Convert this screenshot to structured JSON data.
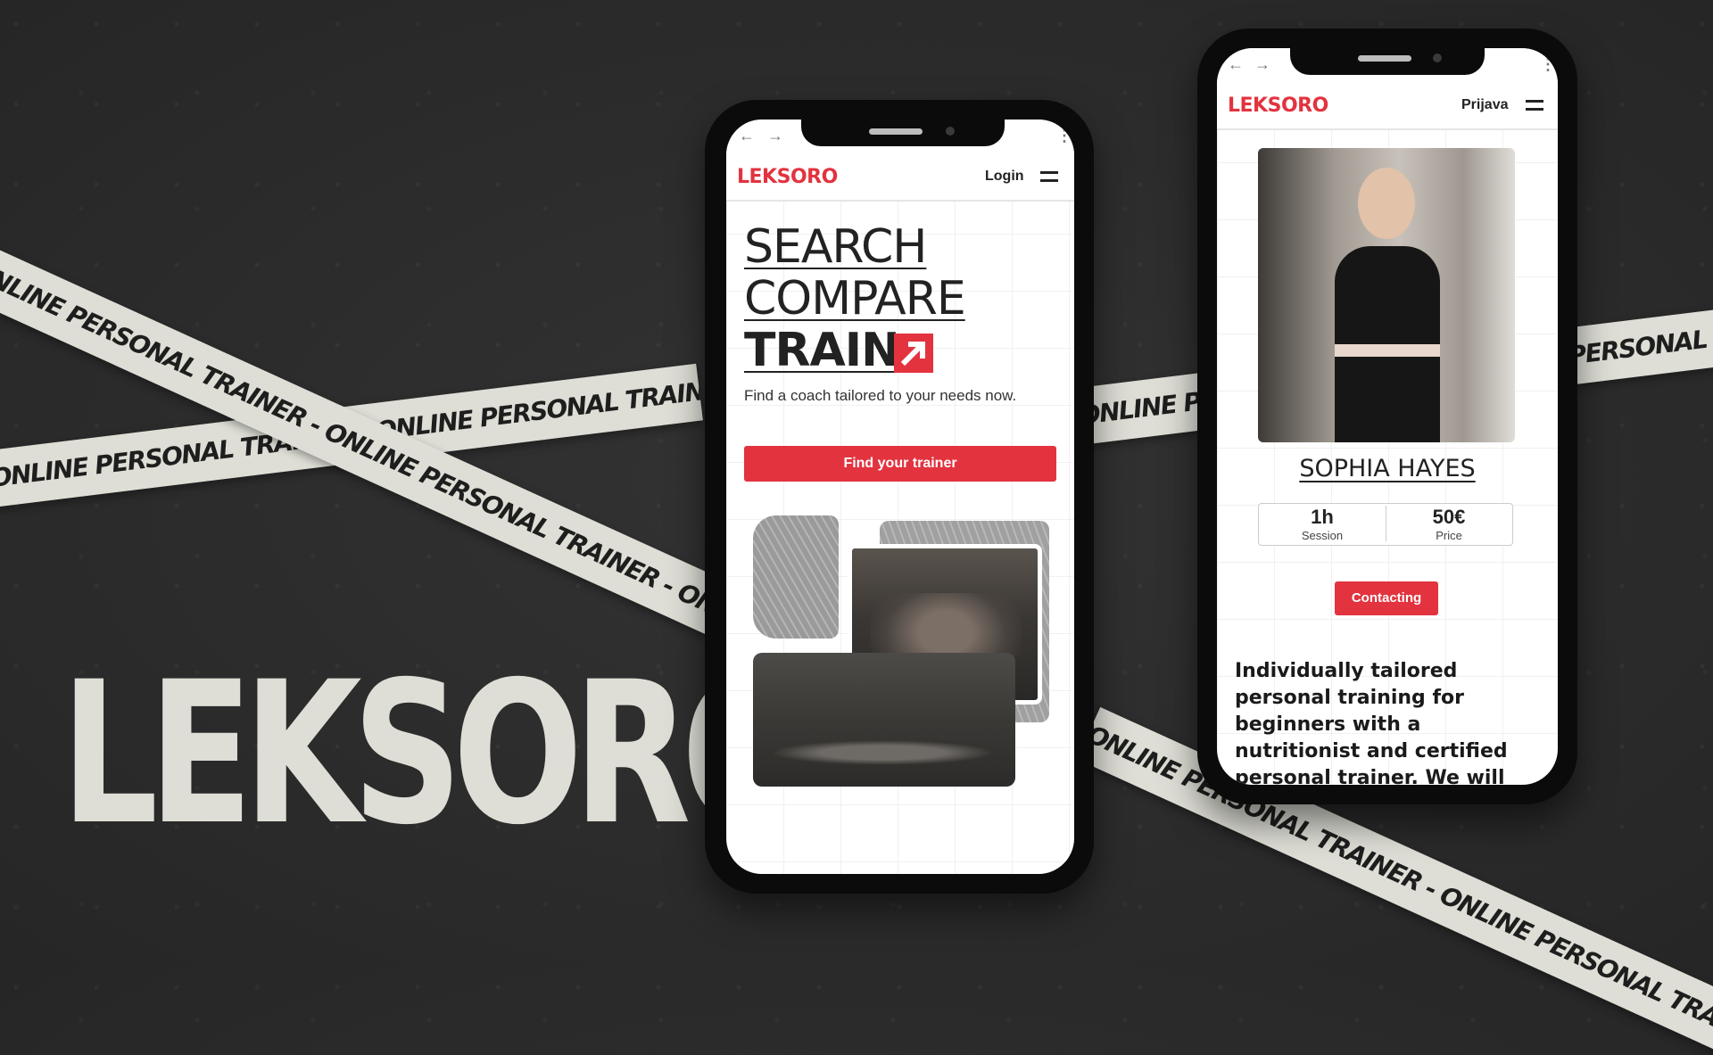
{
  "brand": "LEKSORO",
  "tape_text": "ONLINE PERSONAL TRAINER - ONLINE PERSONAL TRAINER - ONLINE PERSONAL TRAINER - ONLINE PERSONAL TRAINER - ONLINE PERSONAL TRAINER - ONLINE PERSONAL TRAINER -",
  "phone1": {
    "logo": "LEKSORO",
    "login": "Login",
    "hero": [
      "SEARCH",
      "COMPARE",
      "TRAIN"
    ],
    "subtitle": "Find a coach tailored to your needs now.",
    "cta": "Find your trainer"
  },
  "phone2": {
    "logo": "LEKSORO",
    "login": "Prijava",
    "trainer_name": "SOPHIA HAYES",
    "stats": [
      {
        "value": "1h",
        "label": "Session"
      },
      {
        "value": "50€",
        "label": "Price"
      }
    ],
    "contact": "Contacting",
    "description": "Individually tailored personal training for beginners with a nutritionist and certified personal trainer. We will find a routine that suits you!"
  },
  "colors": {
    "accent": "#e2333f",
    "background": "#2b2b2b",
    "tape": "#deded6"
  }
}
